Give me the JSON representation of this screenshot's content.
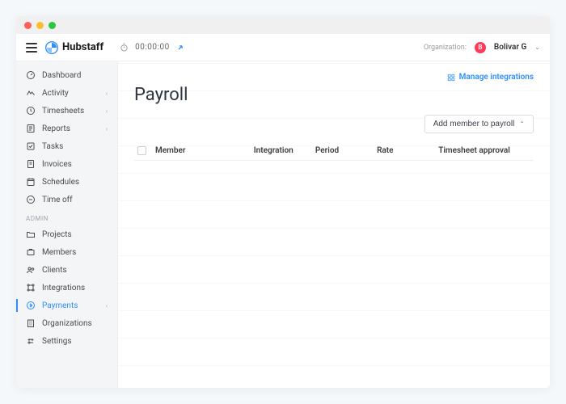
{
  "brand": "Hubstaff",
  "timer": "00:00:00",
  "org_label": "Organization:",
  "user": {
    "initial": "B",
    "name": "Bolivar G"
  },
  "sidebar": {
    "items": [
      {
        "label": "Dashboard",
        "icon": "dashboard",
        "expandable": false
      },
      {
        "label": "Activity",
        "icon": "activity",
        "expandable": true
      },
      {
        "label": "Timesheets",
        "icon": "timesheets",
        "expandable": true
      },
      {
        "label": "Reports",
        "icon": "reports",
        "expandable": true
      },
      {
        "label": "Tasks",
        "icon": "tasks",
        "expandable": false
      },
      {
        "label": "Invoices",
        "icon": "invoices",
        "expandable": false
      },
      {
        "label": "Schedules",
        "icon": "schedules",
        "expandable": false
      },
      {
        "label": "Time off",
        "icon": "timeoff",
        "expandable": false
      }
    ],
    "admin_label": "Admin",
    "admin_items": [
      {
        "label": "Projects",
        "icon": "projects",
        "expandable": false
      },
      {
        "label": "Members",
        "icon": "members",
        "expandable": false
      },
      {
        "label": "Clients",
        "icon": "clients",
        "expandable": false
      },
      {
        "label": "Integrations",
        "icon": "integrations",
        "expandable": false
      },
      {
        "label": "Payments",
        "icon": "payments",
        "expandable": true,
        "active": true
      },
      {
        "label": "Organizations",
        "icon": "organizations",
        "expandable": false
      },
      {
        "label": "Settings",
        "icon": "settings",
        "expandable": false
      }
    ]
  },
  "page": {
    "title": "Payroll",
    "manage_link": "Manage integrations",
    "add_button": "Add member to payroll",
    "columns": [
      "Member",
      "Integration",
      "Period",
      "Rate",
      "Timesheet approval"
    ]
  }
}
